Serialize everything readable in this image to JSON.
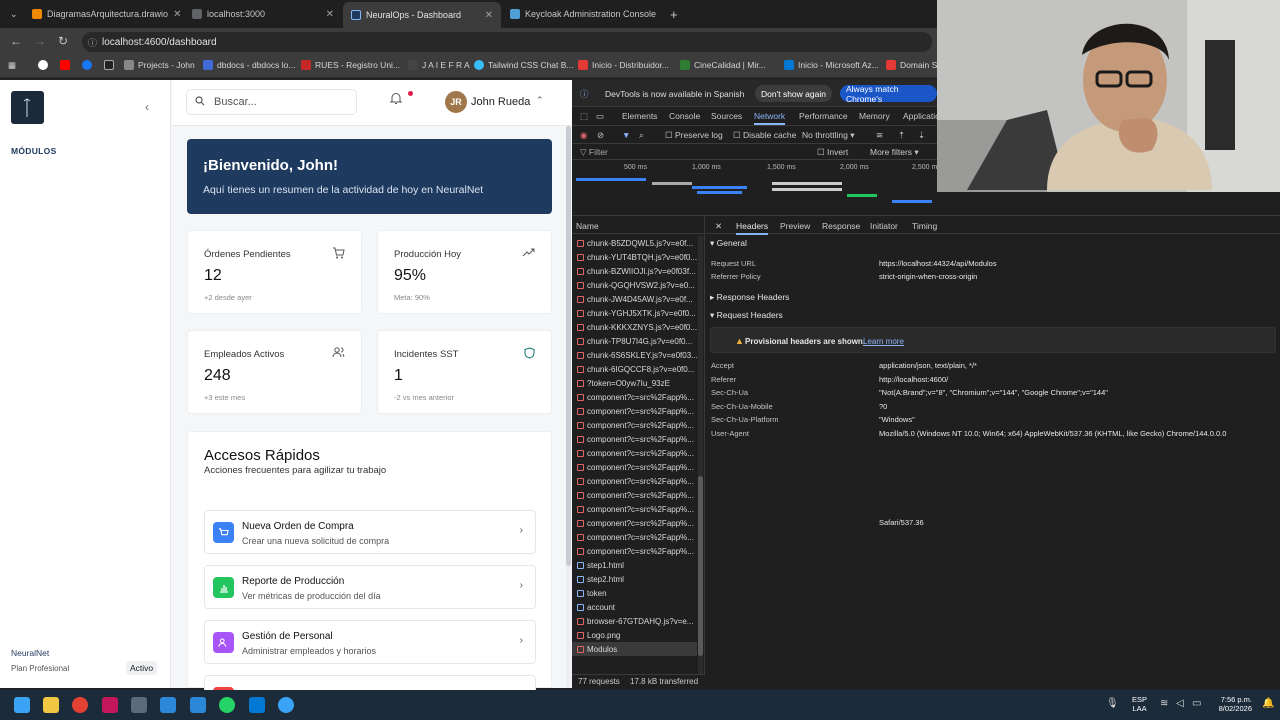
{
  "browser": {
    "tabs": [
      {
        "title": "DiagramasArquitectura.drawio",
        "active": false
      },
      {
        "title": "localhost:3000",
        "active": false
      },
      {
        "title": "NeuralOps - Dashboard",
        "active": true
      },
      {
        "title": "Keycloak Administration Console",
        "active": false
      }
    ],
    "url": "localhost:4600/dashboard",
    "bookmarks": [
      "Projects - John",
      "dbdocs - dbdocs lo...",
      "RUES - Registro Uni...",
      "J A I E F R A",
      "Tailwind CSS Chat B...",
      "Inicio - Distribuidor...",
      "CineCalidad | Mir...",
      "Inicio - Microsoft Az...",
      "Domain Se"
    ]
  },
  "sidebar": {
    "section_label": "MÓDULOS",
    "footer_name": "NeuralNet",
    "footer_plan": "Plan Profesional",
    "footer_badge": "Activo"
  },
  "topbar": {
    "search_placeholder": "Buscar...",
    "user_initials": "JR",
    "user_name": "John Rueda"
  },
  "welcome": {
    "title": "¡Bienvenido, John!",
    "subtitle": "Aquí tienes un resumen de la actividad de hoy en NeuralNet"
  },
  "stats": [
    {
      "title": "Órdenes Pendientes",
      "value": "12",
      "sub": "+2 desde ayer",
      "icon": "cart-icon"
    },
    {
      "title": "Producción Hoy",
      "value": "95%",
      "sub": "Meta: 90%",
      "icon": "trend-up-icon"
    },
    {
      "title": "Empleados Activos",
      "value": "248",
      "sub": "+3 este mes",
      "icon": "users-icon"
    },
    {
      "title": "Incidentes SST",
      "value": "1",
      "sub": "-2 vs mes anterior",
      "icon": "shield-icon"
    }
  ],
  "quick_access": {
    "title": "Accesos Rápidos",
    "subtitle": "Acciones frecuentes para agilizar tu trabajo",
    "items": [
      {
        "title": "Nueva Orden de Compra",
        "sub": "Crear una nueva solicitud de compra",
        "color": "#3b82f6",
        "icon": "cart-icon"
      },
      {
        "title": "Reporte de Producción",
        "sub": "Ver métricas de producción del día",
        "color": "#22c55e",
        "icon": "chart-icon"
      },
      {
        "title": "Gestión de Personal",
        "sub": "Administrar empleados y horarios",
        "color": "#a855f7",
        "icon": "users-icon"
      }
    ]
  },
  "devtools": {
    "info": "DevTools is now available in Spanish",
    "info_btn1": "Don't show again",
    "info_btn2": "Always match Chrome's",
    "tabs": [
      "Elements",
      "Console",
      "Sources",
      "Network",
      "Performance",
      "Memory",
      "Applicatio"
    ],
    "preserve_log": "Preserve log",
    "disable_cache": "Disable cache",
    "throttling": "No throttling",
    "filter": "Filter",
    "invert": "Invert",
    "more_filters": "More filters",
    "timeline_labels": [
      "500 ms",
      "1,000 ms",
      "1,500 ms",
      "2,000 ms",
      "2,500 ms"
    ],
    "name_header": "Name",
    "requests": [
      "chunk-B5ZDQWL5.js?v=e0f...",
      "chunk-YUT4BTQH.js?v=e0f0...",
      "chunk-BZWIIOJI.js?v=e0f03f...",
      "chunk-QGQHVSW2.js?v=e0...",
      "chunk-JW4D45AW.js?v=e0f...",
      "chunk-YGHJ5XTK.js?v=e0f0...",
      "chunk-KKKXZNYS.js?v=e0f0...",
      "chunk-TP8U7I4G.js?v=e0f0...",
      "chunk-6S6SKLEY.js?v=e0f03...",
      "chunk-6IGQCCF8.js?v=e0f0...",
      "?token=O0yw7Iu_93zE",
      "component?c=src%2Fapp%...",
      "component?c=src%2Fapp%...",
      "component?c=src%2Fapp%...",
      "component?c=src%2Fapp%...",
      "component?c=src%2Fapp%...",
      "component?c=src%2Fapp%...",
      "component?c=src%2Fapp%...",
      "component?c=src%2Fapp%...",
      "component?c=src%2Fapp%...",
      "component?c=src%2Fapp%...",
      "component?c=src%2Fapp%...",
      "component?c=src%2Fapp%...",
      "step1.html",
      "step2.html",
      "token",
      "account",
      "browser-67GTDAHQ.js?v=e...",
      "Logo.png",
      "Modulos"
    ],
    "status_requests": "77 requests",
    "status_transferred": "17.8 kB transferred",
    "detail_tabs": [
      "Headers",
      "Preview",
      "Response",
      "Initiator",
      "Timing"
    ],
    "general_label": "General",
    "request_url_key": "Request URL",
    "request_url": "https://localhost:44324/api/Modulos",
    "referrer_policy_key": "Referrer Policy",
    "referrer_policy": "strict-origin-when-cross-origin",
    "response_headers_label": "Response Headers",
    "request_headers_label": "Request Headers",
    "warning": "Provisional headers are shown.",
    "learn_more": "Learn more",
    "req_headers": [
      {
        "k": "Accept",
        "v": "application/json, text/plain, */*"
      },
      {
        "k": "Referer",
        "v": "http://localhost:4600/"
      },
      {
        "k": "Sec-Ch-Ua",
        "v": "\"Not(A:Brand\";v=\"8\", \"Chromium\";v=\"144\", \"Google Chrome\";v=\"144\""
      },
      {
        "k": "Sec-Ch-Ua-Mobile",
        "v": "?0"
      },
      {
        "k": "Sec-Ch-Ua-Platform",
        "v": "\"Windows\""
      },
      {
        "k": "User-Agent",
        "v": "Mozilla/5.0 (Windows NT 10.0; Win64; x64) AppleWebKit/537.36 (KHTML, like Gecko) Chrome/144.0.0.0"
      }
    ],
    "user_agent_cont": "Safari/537.36"
  },
  "taskbar": {
    "lang": "ESP",
    "lang2": "LAA",
    "time": "7:56 p.m.",
    "date": "8/02/2026"
  }
}
